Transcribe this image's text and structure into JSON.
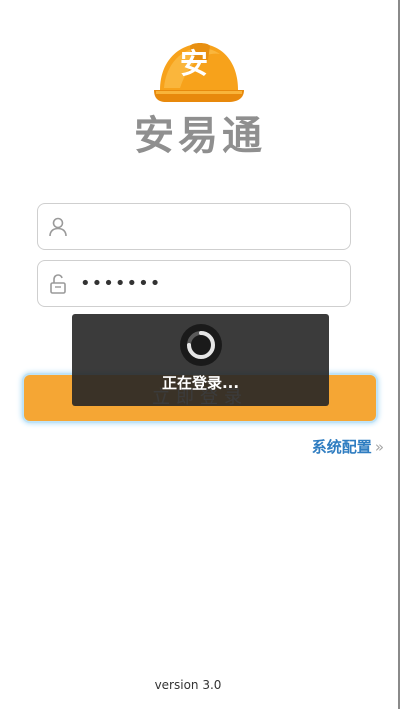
{
  "app": {
    "logo_char": "安",
    "name": "安易通"
  },
  "login_form": {
    "username": {
      "value": "",
      "icon": "user-icon"
    },
    "password": {
      "masked_value": "•••••••",
      "icon": "unlock-icon"
    },
    "login_button_label": "立即登录",
    "config_link_label": "系统配置",
    "config_link_icon": "double-chevron-right-icon"
  },
  "loading": {
    "text": "正在登录...",
    "icon": "spinner-icon"
  },
  "footer": {
    "version": "version 3.0"
  },
  "colors": {
    "accent": "#f5a634",
    "link": "#2f7dc1",
    "logo_text": "#8f8f8f",
    "toast_bg": "#262626"
  }
}
